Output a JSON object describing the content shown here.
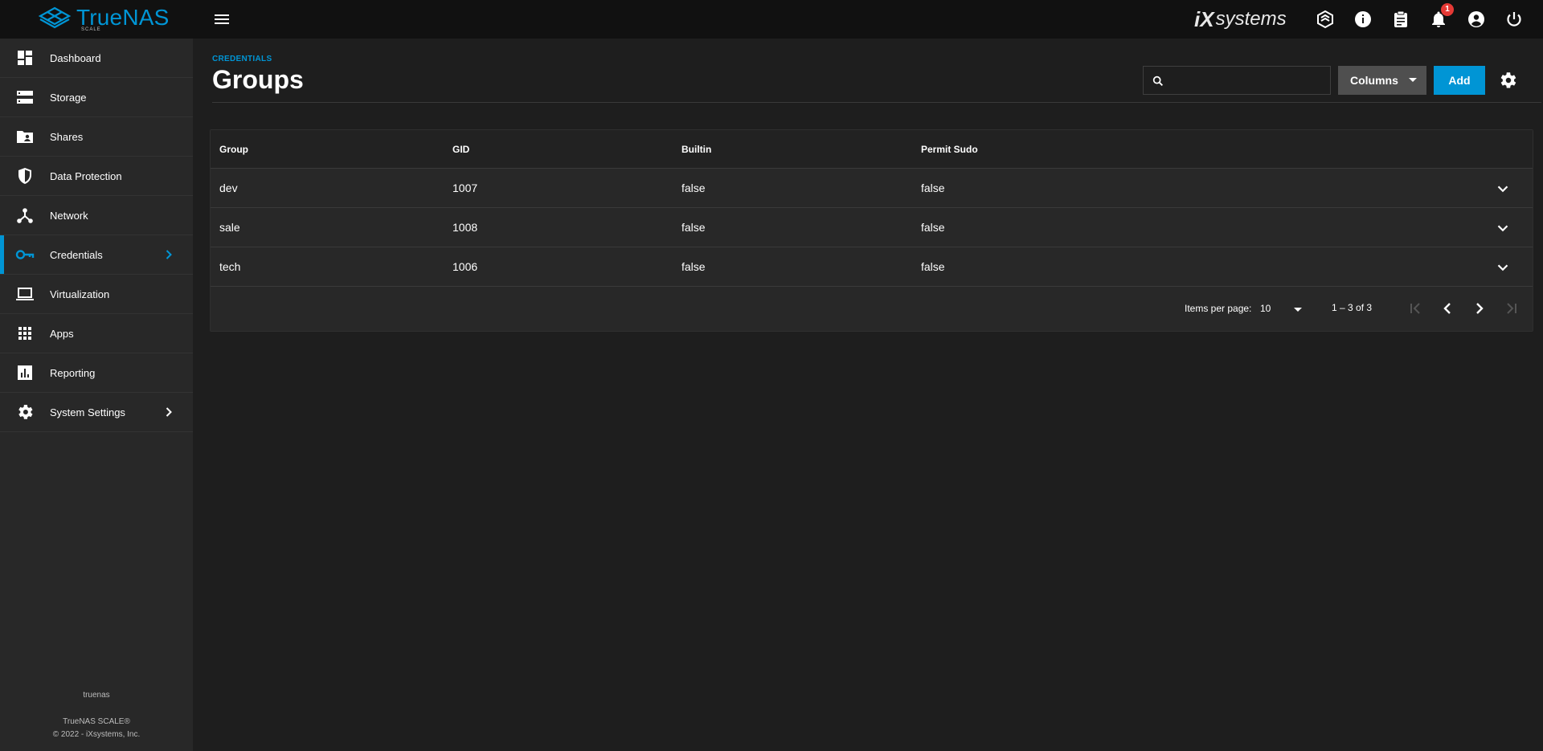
{
  "brand": {
    "name": "TrueNAS",
    "edition": "SCALE",
    "vendor": "systems",
    "vendor_mark": "iX"
  },
  "topbar": {
    "icons": [
      "menu-icon",
      "truecommand-icon",
      "info-icon",
      "jobs-icon",
      "notifications-icon",
      "account-icon",
      "power-icon"
    ],
    "notification_count": "1"
  },
  "sidebar": {
    "items": [
      {
        "label": "Dashboard",
        "icon": "dashboard-icon"
      },
      {
        "label": "Storage",
        "icon": "storage-icon"
      },
      {
        "label": "Shares",
        "icon": "shares-icon"
      },
      {
        "label": "Data Protection",
        "icon": "shield-icon"
      },
      {
        "label": "Network",
        "icon": "network-icon"
      },
      {
        "label": "Credentials",
        "icon": "key-icon",
        "active": true
      },
      {
        "label": "Virtualization",
        "icon": "laptop-icon"
      },
      {
        "label": "Apps",
        "icon": "apps-grid-icon"
      },
      {
        "label": "Reporting",
        "icon": "chart-icon"
      },
      {
        "label": "System Settings",
        "icon": "gear-icon"
      }
    ],
    "footer": {
      "hostname": "truenas",
      "product": "TrueNAS SCALE®",
      "copyright": "© 2022 - iXsystems, Inc."
    }
  },
  "page": {
    "breadcrumb": "CREDENTIALS",
    "title": "Groups",
    "search_placeholder": "",
    "columns_label": "Columns",
    "add_label": "Add"
  },
  "table": {
    "headers": [
      "Group",
      "GID",
      "Builtin",
      "Permit Sudo"
    ],
    "rows": [
      [
        "dev",
        "1007",
        "false",
        "false"
      ],
      [
        "sale",
        "1008",
        "false",
        "false"
      ],
      [
        "tech",
        "1006",
        "false",
        "false"
      ]
    ]
  },
  "paginator": {
    "items_per_page_label": "Items per page:",
    "items_per_page": "10",
    "range": "1 – 3 of 3"
  },
  "colors": {
    "accent": "#0095d5",
    "background": "#1e1e1e",
    "panel": "#282828",
    "topbar": "#111111",
    "badge": "#e53935"
  }
}
